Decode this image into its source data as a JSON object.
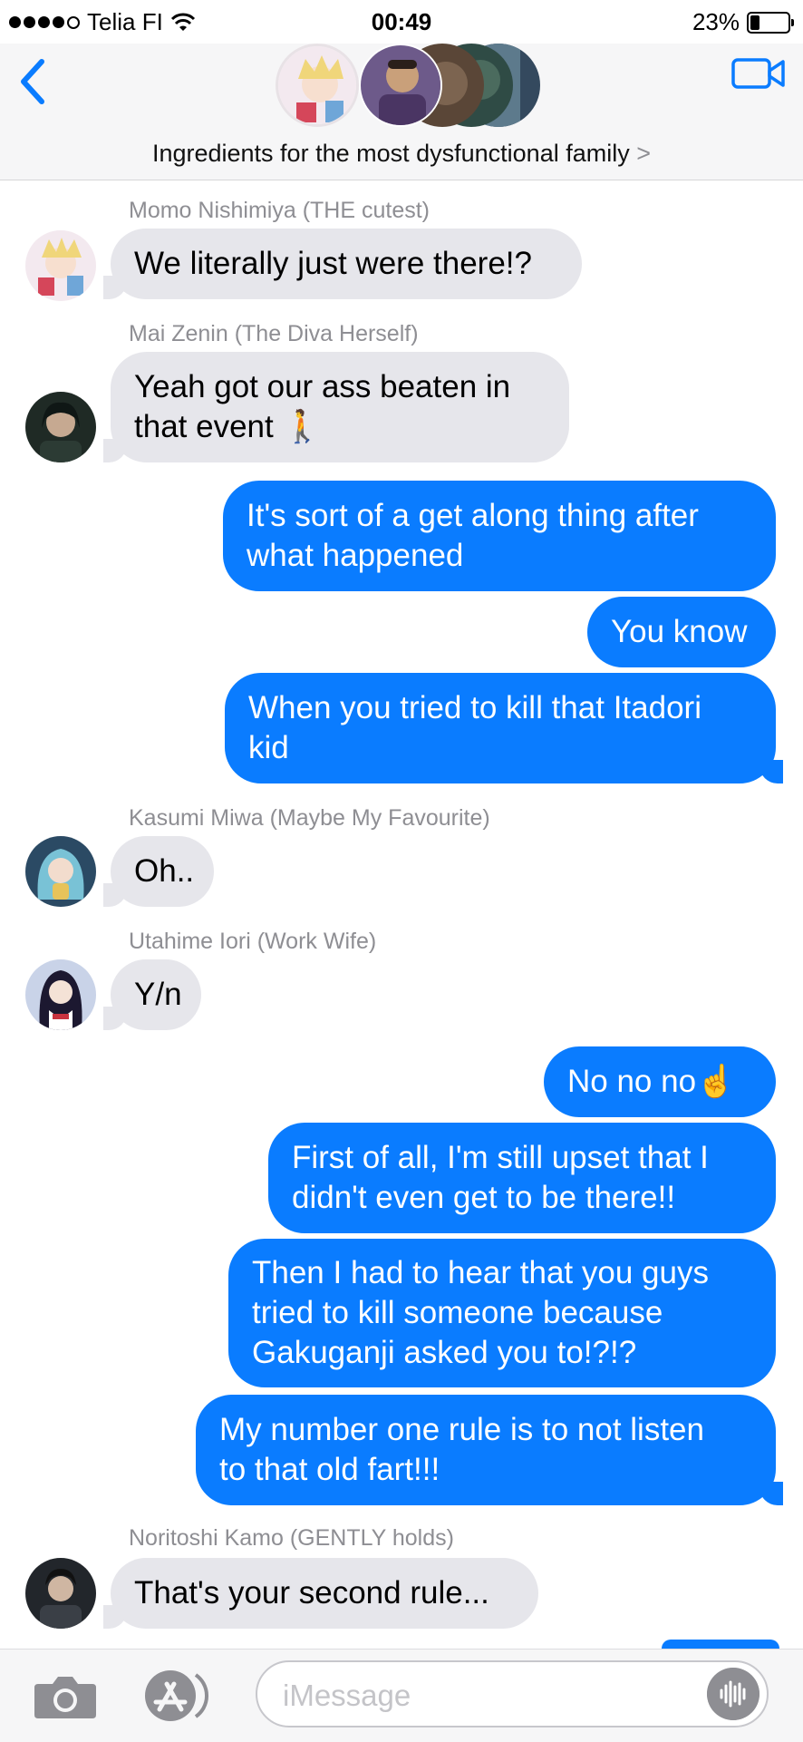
{
  "status_bar": {
    "carrier": "Telia FI",
    "time": "00:49",
    "battery": "23%"
  },
  "header": {
    "group_name": "Ingredients for the most dysfunctional family",
    "chevron": ">"
  },
  "messages": [
    {
      "sender": "Momo Nishimiya (THE cutest)",
      "text": "We literally just were there!?"
    },
    {
      "sender": "Mai Zenin (The Diva Herself)",
      "text": "Yeah got our ass beaten in\nthat event 🚶"
    },
    {
      "text": "It's sort of a get along thing after\nwhat happened"
    },
    {
      "text": "You know"
    },
    {
      "text": "When you tried to kill that Itadori\nkid"
    },
    {
      "sender": "Kasumi Miwa (Maybe My Favourite)",
      "text": "Oh.."
    },
    {
      "sender": "Utahime Iori (Work Wife)",
      "text": "Y/n"
    },
    {
      "text": "No no no☝️"
    },
    {
      "text": "First of all, I'm still upset that I\ndidn't even get to be there!!"
    },
    {
      "text": "Then I had to hear that you guys\ntried to kill someone because\nGakuganji asked you to!?!?"
    },
    {
      "text": "My number one rule is to not listen\nto that old fart!!!"
    },
    {
      "sender": "Noritoshi Kamo (GENTLY holds)",
      "text": "That's your second rule..."
    }
  ],
  "input": {
    "placeholder": "iMessage"
  },
  "colors": {
    "outgoing": "#0a7cff",
    "incoming": "#e6e6eb",
    "accent": "#0a7cff"
  },
  "icons": [
    "signal-dots-icon",
    "wifi-icon",
    "battery-icon",
    "back-chevron-icon",
    "video-camera-icon",
    "camera-icon",
    "app-store-icon",
    "audio-waveform-icon"
  ]
}
